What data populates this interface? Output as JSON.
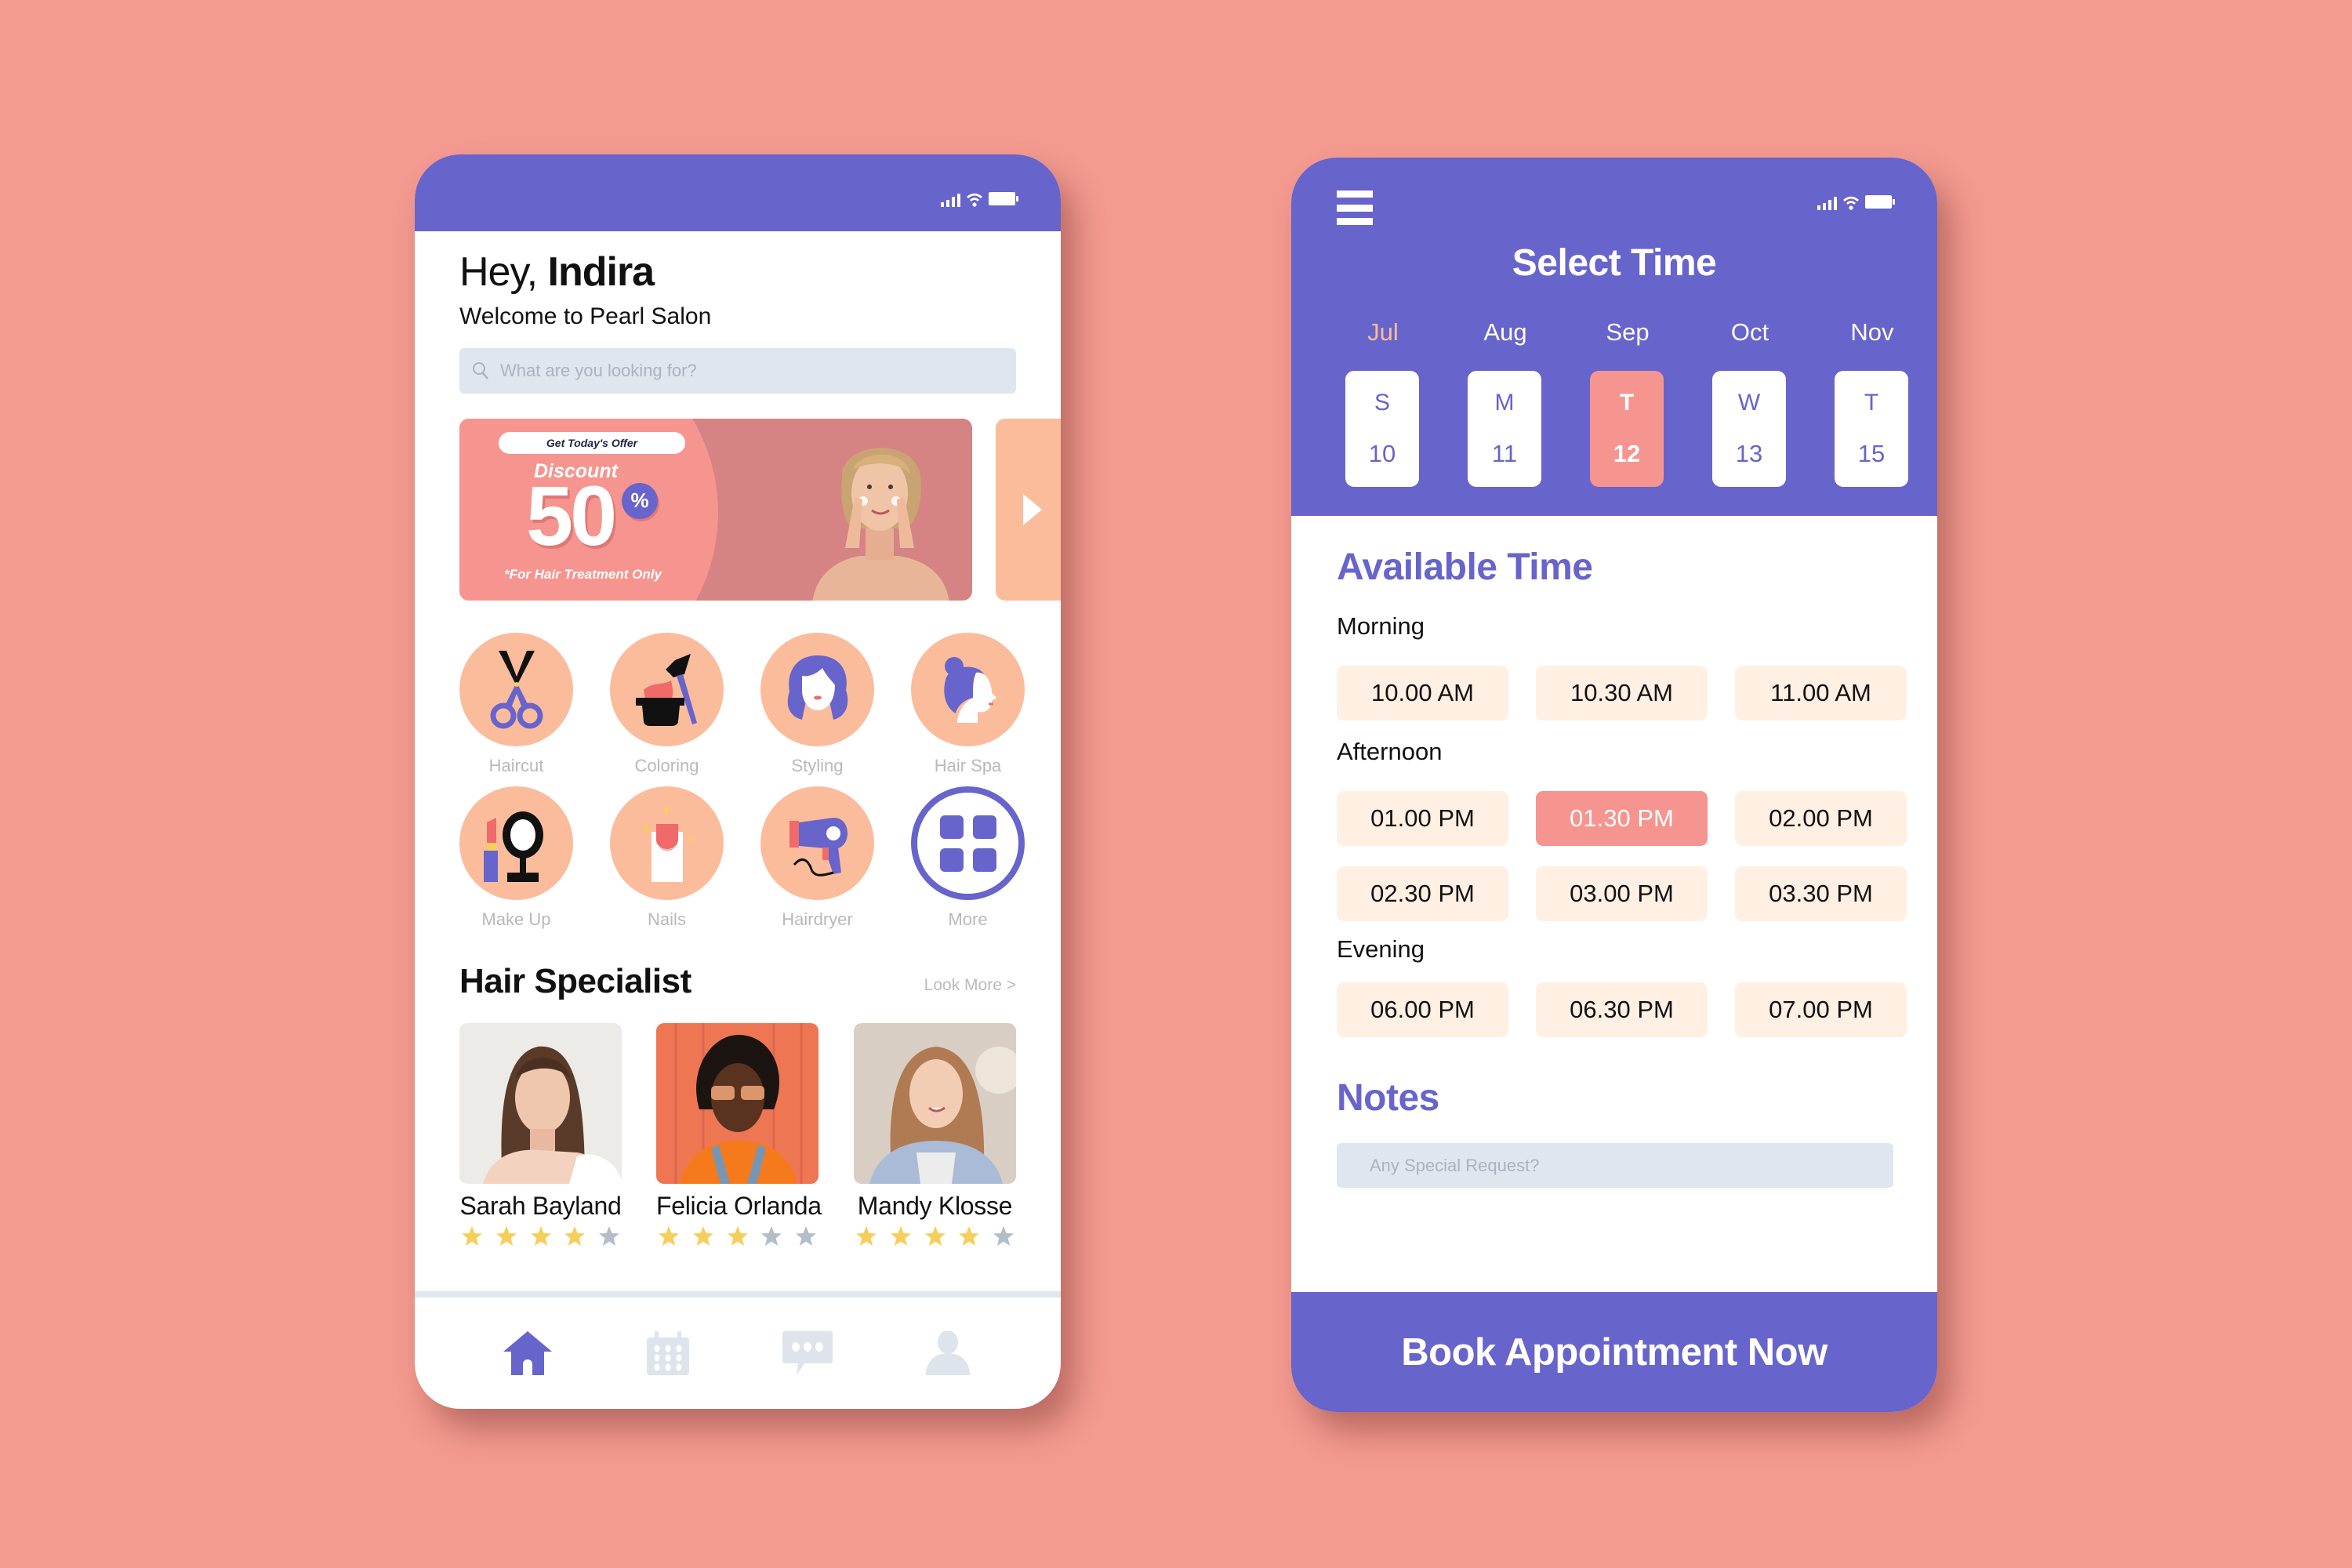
{
  "colors": {
    "background": "#F49A90",
    "primary": "#6764CB",
    "accent_salmon": "#F6958F",
    "accent_peach": "#FBBC9C",
    "slot_bg": "#FFF0E3",
    "input_bg": "#DFE6EE",
    "star_on": "#F7CE5B",
    "star_off": "#B5BDC9"
  },
  "home": {
    "greeting_prefix": "Hey,",
    "user_name": "Indira",
    "welcome": "Welcome to Pearl Salon",
    "search_placeholder": "What are you looking for?",
    "banner": {
      "pill": "Get Today's Offer",
      "label": "Discount",
      "amount": "50",
      "percent_sign": "%",
      "note": "*For Hair Treatment Only"
    },
    "services": [
      {
        "label": "Haircut",
        "icon": "scissors-icon"
      },
      {
        "label": "Coloring",
        "icon": "hair-dye-icon"
      },
      {
        "label": "Styling",
        "icon": "hairstyle-icon"
      },
      {
        "label": "Hair Spa",
        "icon": "hair-spa-icon"
      },
      {
        "label": "Make Up",
        "icon": "makeup-mirror-icon"
      },
      {
        "label": "Nails",
        "icon": "nail-icon"
      },
      {
        "label": "Hairdryer",
        "icon": "hairdryer-icon"
      },
      {
        "label": "More",
        "icon": "grid-icon"
      }
    ],
    "specialists_title": "Hair Specialist",
    "look_more": "Look More >",
    "specialists": [
      {
        "name": "Sarah Bayland",
        "rating": 4,
        "max": 5
      },
      {
        "name": "Felicia Orlanda",
        "rating": 3,
        "max": 5
      },
      {
        "name": "Mandy Klosse",
        "rating": 4,
        "max": 5
      }
    ],
    "nav": [
      {
        "name": "home",
        "icon": "home-icon",
        "active": true
      },
      {
        "name": "calendar",
        "icon": "calendar-icon",
        "active": false
      },
      {
        "name": "messages",
        "icon": "chat-icon",
        "active": false
      },
      {
        "name": "profile",
        "icon": "user-icon",
        "active": false
      }
    ]
  },
  "booking": {
    "title": "Select Time",
    "months": [
      {
        "label": "Jul",
        "active": true
      },
      {
        "label": "Aug",
        "active": false
      },
      {
        "label": "Sep",
        "active": false
      },
      {
        "label": "Oct",
        "active": false
      },
      {
        "label": "Nov",
        "active": false
      }
    ],
    "days": [
      {
        "weekday": "S",
        "date": "10",
        "selected": false
      },
      {
        "weekday": "M",
        "date": "11",
        "selected": false
      },
      {
        "weekday": "T",
        "date": "12",
        "selected": true
      },
      {
        "weekday": "W",
        "date": "13",
        "selected": false
      },
      {
        "weekday": "T",
        "date": "15",
        "selected": false
      }
    ],
    "available_title": "Available Time",
    "periods": [
      {
        "label": "Morning",
        "slots": [
          "10.00 AM",
          "10.30 AM",
          "11.00 AM"
        ]
      },
      {
        "label": "Afternoon",
        "slots": [
          "01.00 PM",
          "01.30 PM",
          "02.00 PM",
          "02.30 PM",
          "03.00 PM",
          "03.30 PM"
        ]
      },
      {
        "label": "Evening",
        "slots": [
          "06.00 PM",
          "06.30 PM",
          "07.00 PM"
        ]
      }
    ],
    "selected_slot": "01.30 PM",
    "notes_title": "Notes",
    "notes_placeholder": "Any Special Request?",
    "book_button": "Book Appointment Now"
  }
}
